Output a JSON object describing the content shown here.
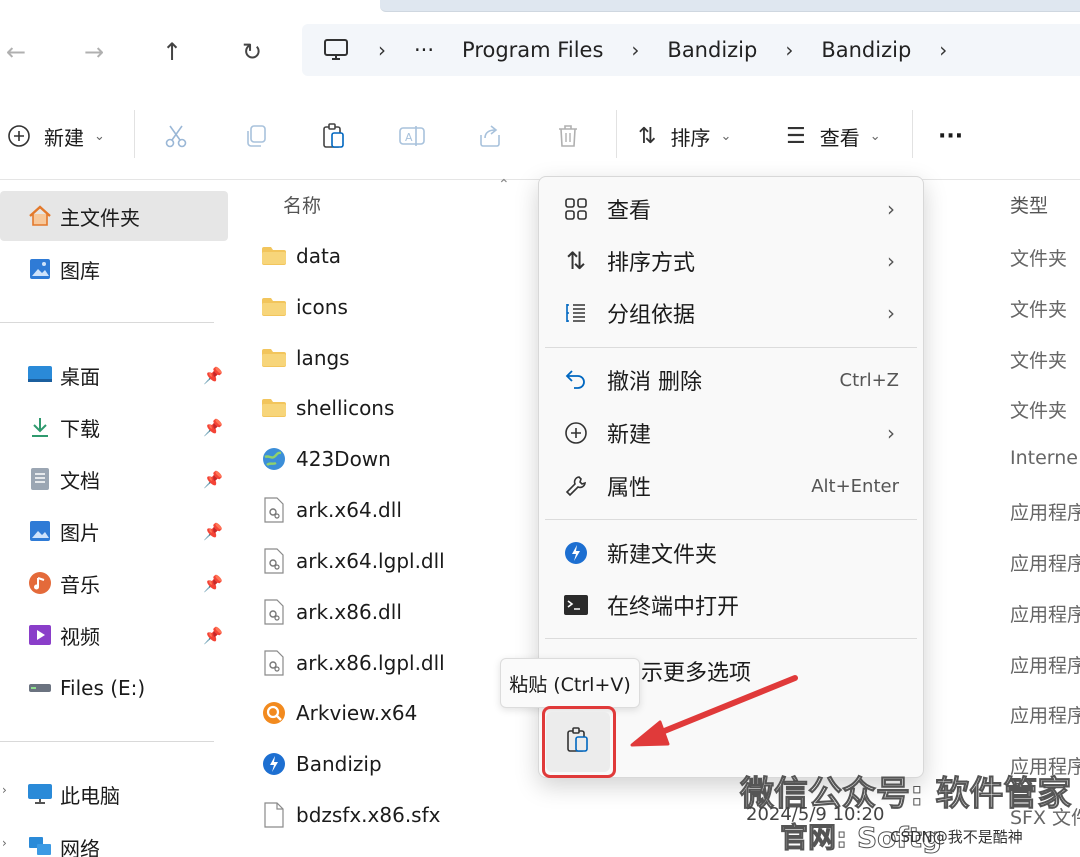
{
  "address": {
    "breadcrumbs": [
      "···",
      "Program Files",
      "Bandizip",
      "Bandizip"
    ]
  },
  "toolbar": {
    "new_label": "新建",
    "sort_label": "排序",
    "view_label": "查看",
    "more_label": "···"
  },
  "sidebar": {
    "items": [
      {
        "label": "主文件夹"
      },
      {
        "label": "图库"
      },
      {
        "label": "桌面"
      },
      {
        "label": "下载"
      },
      {
        "label": "文档"
      },
      {
        "label": "图片"
      },
      {
        "label": "音乐"
      },
      {
        "label": "视频"
      },
      {
        "label": "Files (E:)"
      },
      {
        "label": "此电脑"
      },
      {
        "label": "网络"
      }
    ]
  },
  "filelist": {
    "col_name": "名称",
    "col_type": "类型",
    "rows": [
      {
        "name": "data",
        "type": "文件夹"
      },
      {
        "name": "icons",
        "type": "文件夹"
      },
      {
        "name": "langs",
        "type": "文件夹"
      },
      {
        "name": "shellicons",
        "type": "文件夹"
      },
      {
        "name": "423Down",
        "type": "Interne"
      },
      {
        "name": "ark.x64.dll",
        "type": "应用程序"
      },
      {
        "name": "ark.x64.lgpl.dll",
        "type": "应用程序"
      },
      {
        "name": "ark.x86.dll",
        "type": "应用程序"
      },
      {
        "name": "ark.x86.lgpl.dll",
        "type": "应用程序"
      },
      {
        "name": "Arkview.x64",
        "type": "应用程序"
      },
      {
        "name": "Bandizip",
        "type": "应用程序"
      },
      {
        "name": "bdzsfx.x86.sfx",
        "type": "SFX 文件"
      }
    ]
  },
  "context_menu": {
    "view": "查看",
    "sort_by": "排序方式",
    "group_by": "分组依据",
    "undo_delete": "撤消 删除",
    "undo_shortcut": "Ctrl+Z",
    "new": "新建",
    "properties": "属性",
    "properties_shortcut": "Alt+Enter",
    "new_folder": "新建文件夹",
    "open_terminal": "在终端中打开",
    "more_options": "示更多选项"
  },
  "tooltip": {
    "text": "粘贴 (Ctrl+V)"
  },
  "overlay": {
    "watermark_line1": "微信公众号: 软件管家",
    "watermark_line2": "官网: Softg",
    "date": "2024/5/9 10:20",
    "csdn": "CSDN@我不是酷神"
  },
  "colors": {
    "accent": "#0067c0",
    "folder": "#f2c55c",
    "highlight": "#e03a3a"
  }
}
